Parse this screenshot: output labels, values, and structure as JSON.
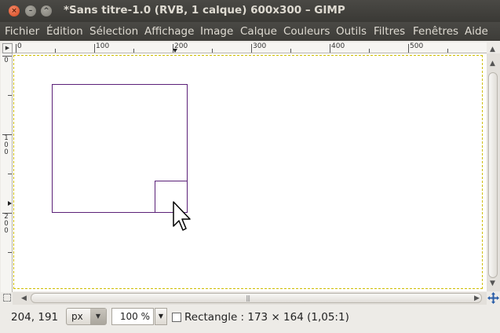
{
  "window": {
    "title": "*Sans titre-1.0 (RVB, 1 calque) 600x300 – GIMP",
    "buttons": {
      "close": "×",
      "minimize": "–",
      "maximize": "^"
    }
  },
  "menu": [
    "Fichier",
    "Édition",
    "Sélection",
    "Affichage",
    "Image",
    "Calque",
    "Couleurs",
    "Outils",
    "Filtres",
    "Fenêtres",
    "Aide"
  ],
  "ruler": {
    "h_labels": [
      "0",
      "100",
      "200",
      "300",
      "400",
      "500"
    ],
    "v_labels": [
      "0",
      "1\n0\n0",
      "2\n0\n0"
    ]
  },
  "status": {
    "coords": "204, 191",
    "unit": "px",
    "zoom": "100 %",
    "message": "Rectangle : 173 × 164  (1,05:1)"
  },
  "colors": {
    "selection": "#5b2078",
    "titlebar": "#3c3b37",
    "layer_boundary": "#e6d300"
  }
}
